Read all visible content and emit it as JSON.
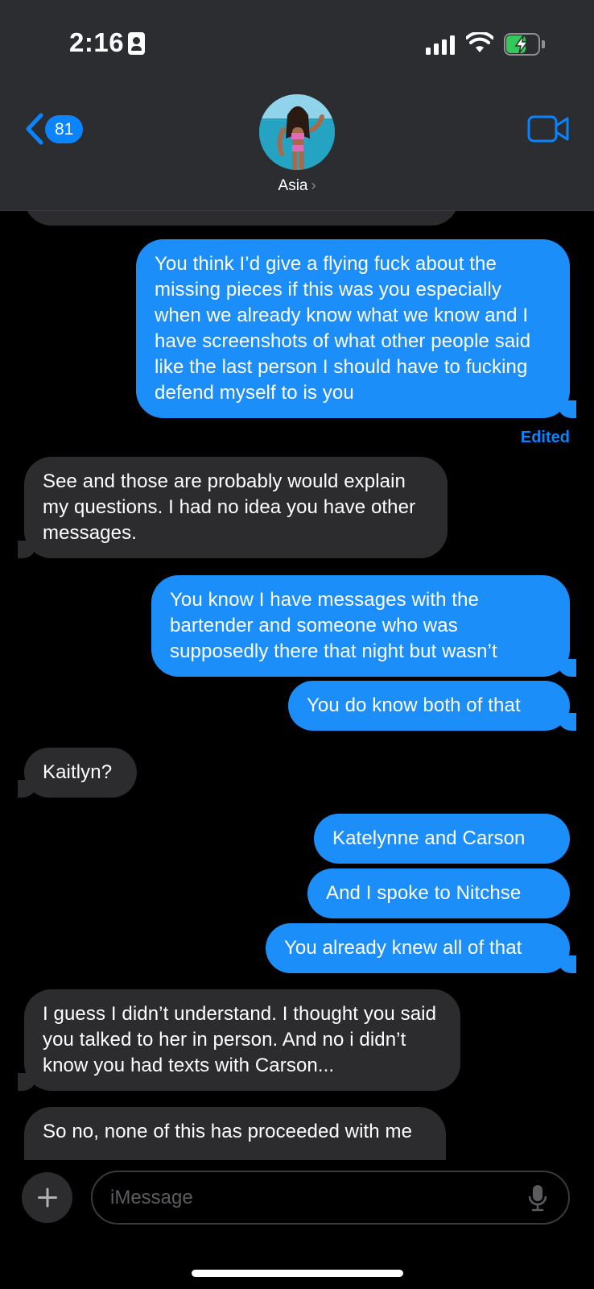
{
  "status_bar": {
    "time": "2:16",
    "icons": [
      "focus-contact-icon",
      "cellular-signal-icon",
      "wifi-icon",
      "battery-charging-icon"
    ]
  },
  "header": {
    "unread_count": "81",
    "contact_name": "Asia",
    "contact_chevron": "›",
    "icons": [
      "back-chevron-icon",
      "contact-avatar",
      "video-call-icon"
    ]
  },
  "messages": [
    {
      "direction": "received",
      "text": "",
      "partial": true
    },
    {
      "direction": "sent",
      "text": "You think I’d give a flying fuck about the missing pieces if this was you especially when we already know what we know and I have screenshots of what other people said like the last person I should have to fucking defend myself to is you"
    },
    {
      "direction": "sent_status",
      "text": "Edited"
    },
    {
      "direction": "received",
      "text": "See and those are probably would explain my questions. I had no idea you have other messages."
    },
    {
      "direction": "sent",
      "text": "You know I have messages with the bartender and someone who was supposedly there that night but wasn’t"
    },
    {
      "direction": "sent",
      "text": "You do know both of that"
    },
    {
      "direction": "received",
      "text": "Kaitlyn?"
    },
    {
      "direction": "sent",
      "text": "Katelynne and Carson"
    },
    {
      "direction": "sent",
      "text": "And I spoke to Nitchse"
    },
    {
      "direction": "sent",
      "text": "You already knew all of that"
    },
    {
      "direction": "received",
      "text": "I guess I didn’t understand. I thought you said you talked to her in person. And no i didn’t know you had texts with Carson..."
    },
    {
      "direction": "received",
      "text": "So no, none of this has proceeded with me",
      "partial": true
    }
  ],
  "compose": {
    "placeholder": "iMessage",
    "icons": [
      "plus-icon",
      "microphone-icon"
    ]
  },
  "colors": {
    "sent_bubble": "#1c8ef9",
    "received_bubble": "#2c2c2e",
    "accent": "#0a84ff",
    "header_bg": "#2b2d30",
    "background": "#000000"
  }
}
